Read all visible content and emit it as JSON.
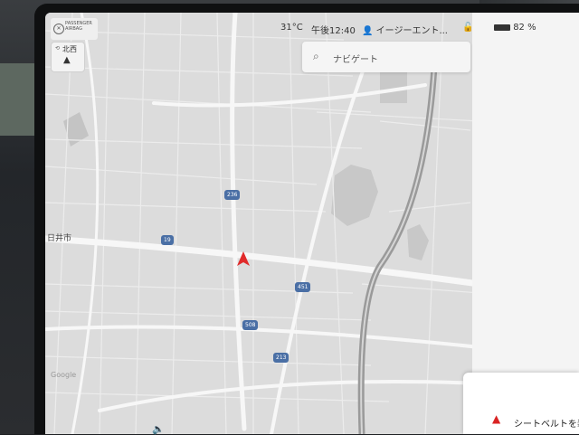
{
  "status": {
    "airbag_line1": "PASSENGER",
    "airbag_line2": "AIRBAG",
    "temperature": "31°C",
    "time": "午後12:40",
    "driver_profile": "イージーエント...",
    "battery": "82 %"
  },
  "compass": {
    "label": "北西"
  },
  "search": {
    "placeholder": "ナビゲート"
  },
  "map": {
    "city_label": "日井市",
    "road_shields": [
      "236",
      "19",
      "451",
      "508",
      "213"
    ],
    "attribution": "Google"
  },
  "alert": {
    "text": "シートベルトを装"
  },
  "colors": {
    "map_bg": "#dcdcdc",
    "road": "#f7f7f7",
    "shield": "#4a6fa5",
    "car_marker": "#e02a2a"
  }
}
